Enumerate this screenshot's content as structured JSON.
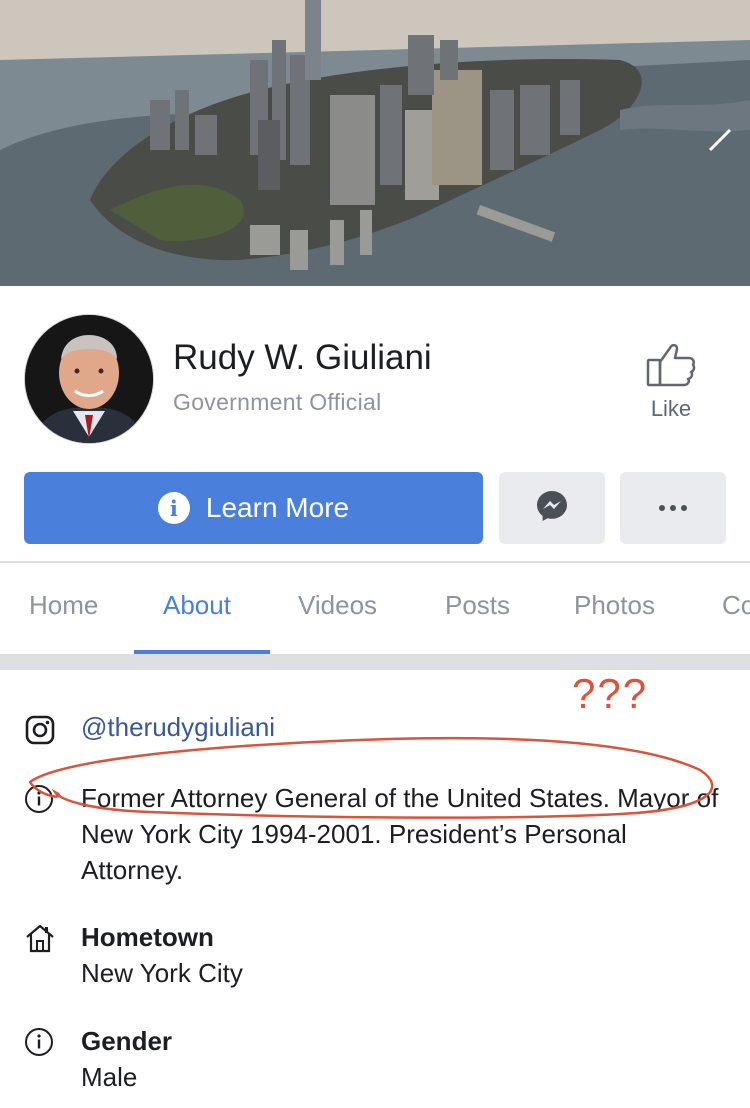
{
  "page": {
    "name": "Rudy W. Giuliani",
    "category": "Government Official"
  },
  "actions": {
    "like_label": "Like",
    "learn_more_label": "Learn More"
  },
  "tabs": [
    {
      "label": "Home",
      "active": false
    },
    {
      "label": "About",
      "active": true
    },
    {
      "label": "Videos",
      "active": false
    },
    {
      "label": "Posts",
      "active": false
    },
    {
      "label": "Photos",
      "active": false
    },
    {
      "label": "Co",
      "active": false
    }
  ],
  "about": {
    "instagram": "@therudygiuliani",
    "description": "Former Attorney General of the United States. Mayor of New York City 1994-2001. President’s Personal Attorney.",
    "hometown": {
      "title": "Hometown",
      "value": "New York City"
    },
    "gender": {
      "title": "Gender",
      "value": "Male"
    }
  },
  "annotation": {
    "text": "???",
    "color": "#d9543b"
  },
  "colors": {
    "accent": "#4a7fdc",
    "link": "#385898",
    "muted": "#8d949e"
  },
  "icons": [
    "thumbs-up-icon",
    "info-icon",
    "messenger-icon",
    "more-icon",
    "instagram-icon",
    "home-icon"
  ]
}
